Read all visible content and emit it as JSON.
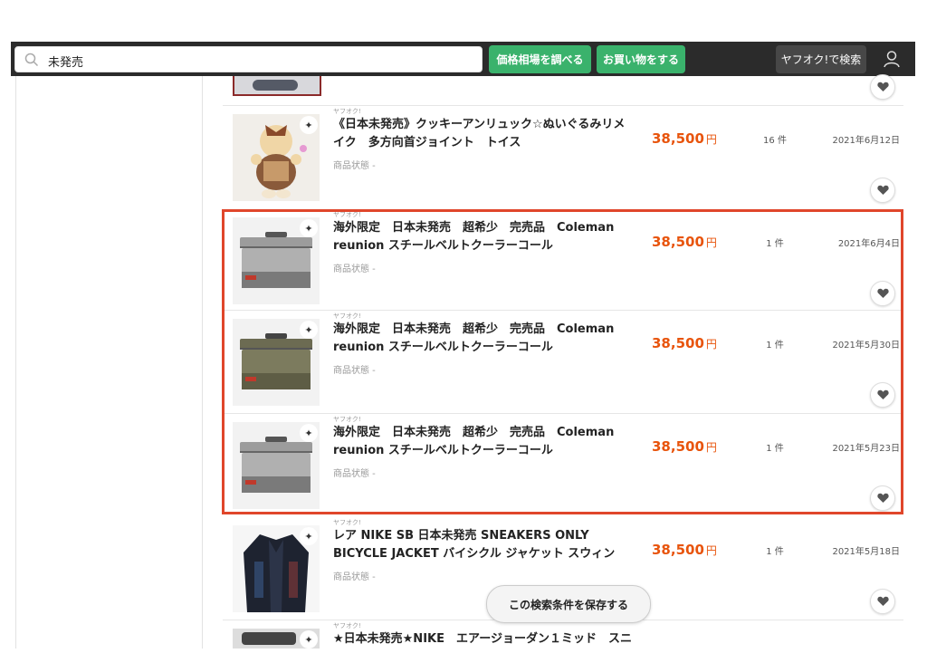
{
  "search": {
    "value": "未発売",
    "placeholder": ""
  },
  "toolbar": {
    "price_check_label": "価格相場を調べる",
    "shop_label": "お買い物をする",
    "yahoo_search_label": "ヤフオク!で検索"
  },
  "rows": [
    {
      "source": "ヤフオク!",
      "title": "《日本未発売》クッキーアンリュック☆ぬいぐるみリメイク　多方向首ジョイント　トイス",
      "condition": "商品状態  -",
      "price": "38,500",
      "price_unit": "円",
      "count": "16 件",
      "date": "2021年6月12日"
    },
    {
      "source": "ヤフオク!",
      "title": "海外限定　日本未発売　超希少　完売品　Coleman reunion スチールベルトクーラーコール",
      "condition": "商品状態  -",
      "price": "38,500",
      "price_unit": "円",
      "count": "1 件",
      "date": "2021年6月4日"
    },
    {
      "source": "ヤフオク!",
      "title": "海外限定　日本未発売　超希少　完売品　Coleman reunion スチールベルトクーラーコール",
      "condition": "商品状態  -",
      "price": "38,500",
      "price_unit": "円",
      "count": "1 件",
      "date": "2021年5月30日"
    },
    {
      "source": "ヤフオク!",
      "title": "海外限定　日本未発売　超希少　完売品　Coleman reunion スチールベルトクーラーコール",
      "condition": "商品状態  -",
      "price": "38,500",
      "price_unit": "円",
      "count": "1 件",
      "date": "2021年5月23日"
    },
    {
      "source": "ヤフオク!",
      "title": "レア NIKE SB 日本未発売 SNEAKERS ONLY BICYCLE JACKET バイシクル ジャケット スウィン",
      "condition": "商品状態  -",
      "price": "38,500",
      "price_unit": "円",
      "count": "1 件",
      "date": "2021年5月18日"
    },
    {
      "source": "ヤフオク!",
      "title": "★日本未発売★NIKE　エアージョーダン１ミッド　スニ"
    }
  ],
  "save_search_label": "この検索条件を保存する",
  "colors": {
    "accent_green": "#3ab26c",
    "price_orange": "#e8540c",
    "highlight_red": "#e0462b"
  }
}
